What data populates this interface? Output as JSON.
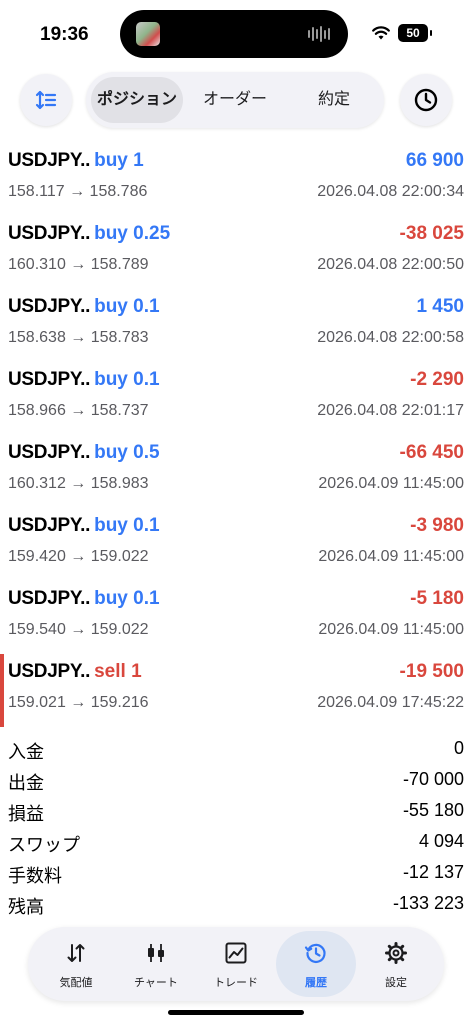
{
  "status_bar": {
    "time": "19:36",
    "battery": "50"
  },
  "toolbar": {
    "segments": [
      {
        "label": "ポジション",
        "active": true
      },
      {
        "label": "オーダー",
        "active": false
      },
      {
        "label": "約定",
        "active": false
      }
    ]
  },
  "trades": [
    {
      "symbol": "USDJPY..",
      "side": "buy 1",
      "side_type": "buy",
      "profit": "66 900",
      "profit_sign": "pos",
      "prices": "158.117 → 158.786",
      "datetime": "2026.04.08 22:00:34"
    },
    {
      "symbol": "USDJPY..",
      "side": "buy 0.25",
      "side_type": "buy",
      "profit": "-38 025",
      "profit_sign": "neg",
      "prices": "160.310 → 158.789",
      "datetime": "2026.04.08 22:00:50"
    },
    {
      "symbol": "USDJPY..",
      "side": "buy 0.1",
      "side_type": "buy",
      "profit": "1 450",
      "profit_sign": "pos",
      "prices": "158.638 → 158.783",
      "datetime": "2026.04.08 22:00:58"
    },
    {
      "symbol": "USDJPY..",
      "side": "buy 0.1",
      "side_type": "buy",
      "profit": "-2 290",
      "profit_sign": "neg",
      "prices": "158.966 → 158.737",
      "datetime": "2026.04.08 22:01:17"
    },
    {
      "symbol": "USDJPY..",
      "side": "buy 0.5",
      "side_type": "buy",
      "profit": "-66 450",
      "profit_sign": "neg",
      "prices": "160.312 → 158.983",
      "datetime": "2026.04.09 11:45:00"
    },
    {
      "symbol": "USDJPY..",
      "side": "buy 0.1",
      "side_type": "buy",
      "profit": "-3 980",
      "profit_sign": "neg",
      "prices": "159.420 → 159.022",
      "datetime": "2026.04.09 11:45:00"
    },
    {
      "symbol": "USDJPY..",
      "side": "buy 0.1",
      "side_type": "buy",
      "profit": "-5 180",
      "profit_sign": "neg",
      "prices": "159.540 → 159.022",
      "datetime": "2026.04.09 11:45:00"
    },
    {
      "symbol": "USDJPY..",
      "side": "sell 1",
      "side_type": "sell",
      "profit": "-19 500",
      "profit_sign": "neg",
      "prices": "159.021 → 159.216",
      "datetime": "2026.04.09 17:45:22"
    }
  ],
  "summary": [
    {
      "label": "入金",
      "value": "0"
    },
    {
      "label": "出金",
      "value": "-70 000"
    },
    {
      "label": "損益",
      "value": "-55 180"
    },
    {
      "label": "スワップ",
      "value": "4 094"
    },
    {
      "label": "手数料",
      "value": "-12 137"
    },
    {
      "label": "残高",
      "value": "-133 223"
    }
  ],
  "tabbar": {
    "tabs": [
      {
        "label": "気配値",
        "icon": "quotes-arrows-icon",
        "active": false
      },
      {
        "label": "チャート",
        "icon": "candlestick-icon",
        "active": false
      },
      {
        "label": "トレード",
        "icon": "trade-chart-icon",
        "active": false
      },
      {
        "label": "履歴",
        "icon": "history-clock-icon",
        "active": true
      },
      {
        "label": "設定",
        "icon": "gear-icon",
        "active": false
      }
    ]
  },
  "colors": {
    "buy": "#3478f6",
    "sell": "#d9473d",
    "accent": "#3478f6"
  }
}
